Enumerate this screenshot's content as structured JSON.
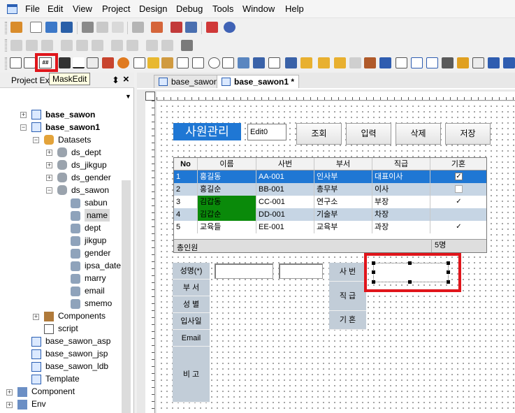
{
  "menu": [
    "File",
    "Edit",
    "View",
    "Project",
    "Design",
    "Debug",
    "Tools",
    "Window",
    "Help"
  ],
  "tooltip": "MaskEdit",
  "toolbar3": {
    "maskedit_glyph": "##"
  },
  "panel": {
    "title": "Project Explorer",
    "pin": "⬍",
    "close": "×",
    "dropdown": "▼"
  },
  "tree": {
    "base_sawon": "base_sawon",
    "base_sawon1": "base_sawon1",
    "datasets": "Datasets",
    "ds_dept": "ds_dept",
    "ds_jikgup": "ds_jikgup",
    "ds_gender": "ds_gender",
    "ds_sawon": "ds_sawon",
    "columns": [
      "sabun",
      "name",
      "dept",
      "jikgup",
      "gender",
      "ipsa_date",
      "marry",
      "email",
      "smemo"
    ],
    "components": "Components",
    "script": "script",
    "base_sawon_asp": "base_sawon_asp",
    "base_sawon_jsp": "base_sawon_jsp",
    "base_sawon_ldb": "base_sawon_ldb",
    "template": "Template",
    "component_root": "Component",
    "env_root": "Env"
  },
  "tabs": [
    {
      "label": "base_sawon"
    },
    {
      "label": "base_sawon1 *"
    }
  ],
  "form": {
    "title": "사원관리",
    "edit0": "Edit0",
    "buttons": [
      "조회",
      "입력",
      "삭제",
      "저장"
    ],
    "grid": {
      "headers": [
        "No",
        "이름",
        "사번",
        "부서",
        "직급",
        "기혼"
      ],
      "rows": [
        {
          "no": "1",
          "name": "홍길동",
          "sabun": "AA-001",
          "dept": "인사부",
          "jik": "대표이사",
          "married": true
        },
        {
          "no": "2",
          "name": "홍길순",
          "sabun": "BB-001",
          "dept": "총무부",
          "jik": "이사",
          "married": false
        },
        {
          "no": "3",
          "name": "김갑동",
          "sabun": "CC-001",
          "dept": "연구소",
          "jik": "부장",
          "married": true
        },
        {
          "no": "4",
          "name": "김갑순",
          "sabun": "DD-001",
          "dept": "기술부",
          "jik": "차장",
          "married": false
        },
        {
          "no": "5",
          "name": "교육들",
          "sabun": "EE-001",
          "dept": "교육부",
          "jik": "과장",
          "married": true
        }
      ],
      "footer_left": "총인원",
      "footer_right": "5명"
    },
    "labels_left": [
      "성명(*)",
      "부 서",
      "성 별",
      "입사일",
      "Email",
      "비 고"
    ],
    "labels_right": [
      "사 번",
      "직 급",
      "기 혼"
    ]
  },
  "colors": {
    "accent": "#1f77d4",
    "highlight_red": "#e0151b",
    "row_selected": "#1f77d4",
    "row_alt": "#c6d5e4",
    "name_green": "#0a8a0a",
    "label_bg": "#c2cdd8"
  }
}
